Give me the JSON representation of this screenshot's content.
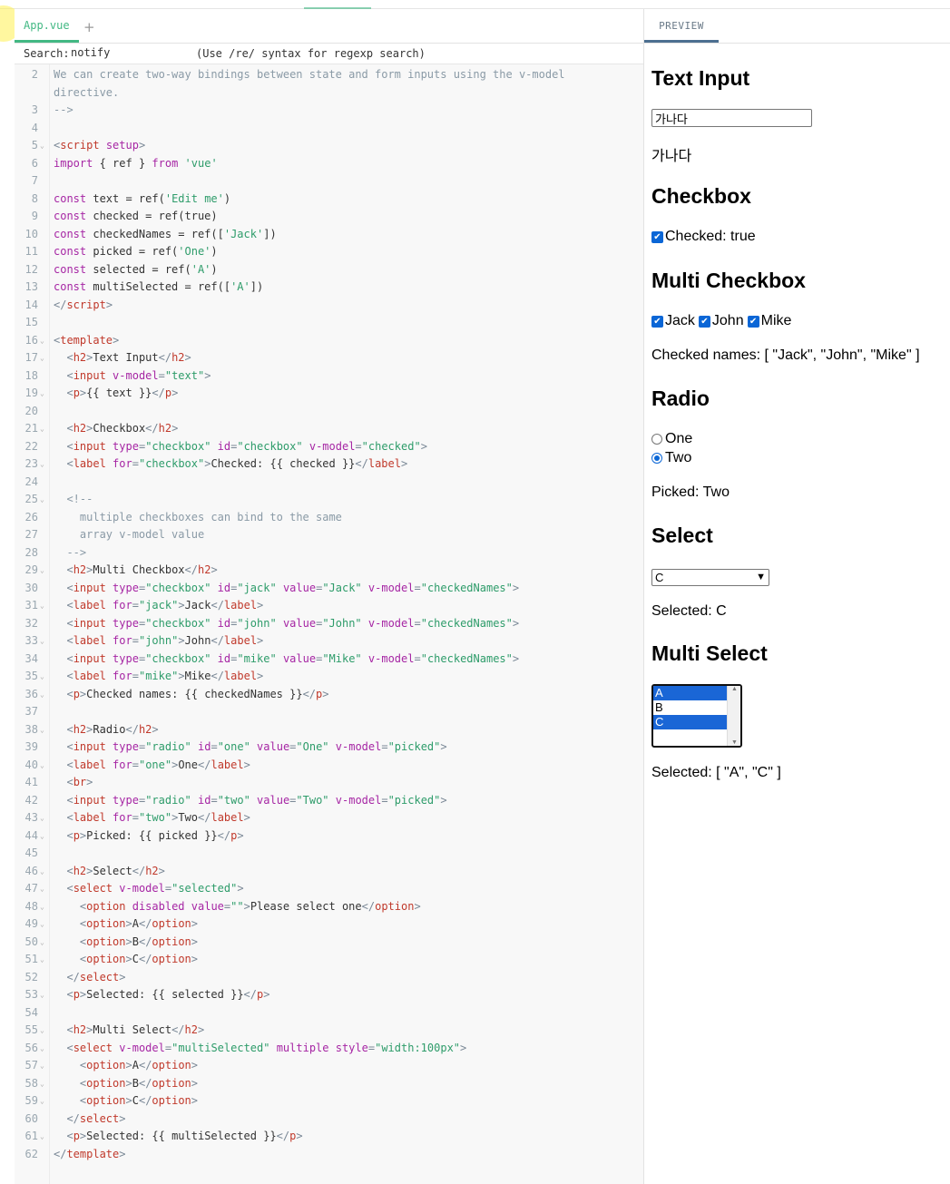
{
  "editor": {
    "tab": "App.vue",
    "add_tab": "+",
    "search_label": "Search:",
    "search_value": "notify",
    "search_hint": "(Use /re/ syntax for regexp search)",
    "lines": [
      {
        "n": "2",
        "fold": "",
        "html": "<span class='t-c'>We can create two-way bindings between state and form inputs using the v-model</span>"
      },
      {
        "n": "",
        "fold": "",
        "html": "<span class='t-c'>directive.</span>"
      },
      {
        "n": "3",
        "fold": "",
        "html": "<span class='t-c'>--></span>"
      },
      {
        "n": "4",
        "fold": "",
        "html": ""
      },
      {
        "n": "5",
        "fold": "v",
        "html": "<span class='t-p'>&lt;</span><span class='t-t'>script</span> <span class='t-a'>setup</span><span class='t-p'>&gt;</span>"
      },
      {
        "n": "6",
        "fold": "",
        "html": "<span class='t-k'>import</span> <span class='t-n'>{ ref }</span> <span class='t-k'>from</span> <span class='t-s'>'vue'</span>"
      },
      {
        "n": "7",
        "fold": "",
        "html": ""
      },
      {
        "n": "8",
        "fold": "",
        "html": "<span class='t-k'>const</span> <span class='t-n'>text = ref(</span><span class='t-s'>'Edit me'</span><span class='t-n'>)</span>"
      },
      {
        "n": "9",
        "fold": "",
        "html": "<span class='t-k'>const</span> <span class='t-n'>checked = ref(true)</span>"
      },
      {
        "n": "10",
        "fold": "",
        "html": "<span class='t-k'>const</span> <span class='t-n'>checkedNames = ref([</span><span class='t-s'>'Jack'</span><span class='t-n'>])</span>"
      },
      {
        "n": "11",
        "fold": "",
        "html": "<span class='t-k'>const</span> <span class='t-n'>picked = ref(</span><span class='t-s'>'One'</span><span class='t-n'>)</span>"
      },
      {
        "n": "12",
        "fold": "",
        "html": "<span class='t-k'>const</span> <span class='t-n'>selected = ref(</span><span class='t-s'>'A'</span><span class='t-n'>)</span>"
      },
      {
        "n": "13",
        "fold": "",
        "html": "<span class='t-k'>const</span> <span class='t-n'>multiSelected = ref([</span><span class='t-s'>'A'</span><span class='t-n'>])</span>"
      },
      {
        "n": "14",
        "fold": "",
        "html": "<span class='t-p'>&lt;/</span><span class='t-t'>script</span><span class='t-p'>&gt;</span>"
      },
      {
        "n": "15",
        "fold": "",
        "html": ""
      },
      {
        "n": "16",
        "fold": "v",
        "html": "<span class='t-p'>&lt;</span><span class='t-t'>template</span><span class='t-p'>&gt;</span>"
      },
      {
        "n": "17",
        "fold": "v",
        "html": "  <span class='t-p'>&lt;</span><span class='t-t'>h2</span><span class='t-p'>&gt;</span><span class='t-n'>Text Input</span><span class='t-p'>&lt;/</span><span class='t-t'>h2</span><span class='t-p'>&gt;</span>"
      },
      {
        "n": "18",
        "fold": "",
        "html": "  <span class='t-p'>&lt;</span><span class='t-t'>input</span> <span class='t-a'>v-model</span><span class='t-p'>=</span><span class='t-s'>\"text\"</span><span class='t-p'>&gt;</span>"
      },
      {
        "n": "19",
        "fold": "v",
        "html": "  <span class='t-p'>&lt;</span><span class='t-t'>p</span><span class='t-p'>&gt;</span><span class='t-n'>{{ text }}</span><span class='t-p'>&lt;/</span><span class='t-t'>p</span><span class='t-p'>&gt;</span>"
      },
      {
        "n": "20",
        "fold": "",
        "html": ""
      },
      {
        "n": "21",
        "fold": "v",
        "html": "  <span class='t-p'>&lt;</span><span class='t-t'>h2</span><span class='t-p'>&gt;</span><span class='t-n'>Checkbox</span><span class='t-p'>&lt;/</span><span class='t-t'>h2</span><span class='t-p'>&gt;</span>"
      },
      {
        "n": "22",
        "fold": "",
        "html": "  <span class='t-p'>&lt;</span><span class='t-t'>input</span> <span class='t-a'>type</span><span class='t-p'>=</span><span class='t-s'>\"checkbox\"</span> <span class='t-a'>id</span><span class='t-p'>=</span><span class='t-s'>\"checkbox\"</span> <span class='t-a'>v-model</span><span class='t-p'>=</span><span class='t-s'>\"checked\"</span><span class='t-p'>&gt;</span>"
      },
      {
        "n": "23",
        "fold": "v",
        "html": "  <span class='t-p'>&lt;</span><span class='t-t'>label</span> <span class='t-a'>for</span><span class='t-p'>=</span><span class='t-s'>\"checkbox\"</span><span class='t-p'>&gt;</span><span class='t-n'>Checked: {{ checked }}</span><span class='t-p'>&lt;/</span><span class='t-t'>label</span><span class='t-p'>&gt;</span>"
      },
      {
        "n": "24",
        "fold": "",
        "html": ""
      },
      {
        "n": "25",
        "fold": "v",
        "html": "  <span class='t-c'>&lt;!--</span>"
      },
      {
        "n": "26",
        "fold": "",
        "html": "    <span class='t-c'>multiple checkboxes can bind to the same</span>"
      },
      {
        "n": "27",
        "fold": "",
        "html": "    <span class='t-c'>array v-model value</span>"
      },
      {
        "n": "28",
        "fold": "",
        "html": "  <span class='t-c'>--></span>"
      },
      {
        "n": "29",
        "fold": "v",
        "html": "  <span class='t-p'>&lt;</span><span class='t-t'>h2</span><span class='t-p'>&gt;</span><span class='t-n'>Multi Checkbox</span><span class='t-p'>&lt;/</span><span class='t-t'>h2</span><span class='t-p'>&gt;</span>"
      },
      {
        "n": "30",
        "fold": "",
        "html": "  <span class='t-p'>&lt;</span><span class='t-t'>input</span> <span class='t-a'>type</span><span class='t-p'>=</span><span class='t-s'>\"checkbox\"</span> <span class='t-a'>id</span><span class='t-p'>=</span><span class='t-s'>\"jack\"</span> <span class='t-a'>value</span><span class='t-p'>=</span><span class='t-s'>\"Jack\"</span> <span class='t-a'>v-model</span><span class='t-p'>=</span><span class='t-s'>\"checkedNames\"</span><span class='t-p'>&gt;</span>"
      },
      {
        "n": "31",
        "fold": "v",
        "html": "  <span class='t-p'>&lt;</span><span class='t-t'>label</span> <span class='t-a'>for</span><span class='t-p'>=</span><span class='t-s'>\"jack\"</span><span class='t-p'>&gt;</span><span class='t-n'>Jack</span><span class='t-p'>&lt;/</span><span class='t-t'>label</span><span class='t-p'>&gt;</span>"
      },
      {
        "n": "32",
        "fold": "",
        "html": "  <span class='t-p'>&lt;</span><span class='t-t'>input</span> <span class='t-a'>type</span><span class='t-p'>=</span><span class='t-s'>\"checkbox\"</span> <span class='t-a'>id</span><span class='t-p'>=</span><span class='t-s'>\"john\"</span> <span class='t-a'>value</span><span class='t-p'>=</span><span class='t-s'>\"John\"</span> <span class='t-a'>v-model</span><span class='t-p'>=</span><span class='t-s'>\"checkedNames\"</span><span class='t-p'>&gt;</span>"
      },
      {
        "n": "33",
        "fold": "v",
        "html": "  <span class='t-p'>&lt;</span><span class='t-t'>label</span> <span class='t-a'>for</span><span class='t-p'>=</span><span class='t-s'>\"john\"</span><span class='t-p'>&gt;</span><span class='t-n'>John</span><span class='t-p'>&lt;/</span><span class='t-t'>label</span><span class='t-p'>&gt;</span>"
      },
      {
        "n": "34",
        "fold": "",
        "html": "  <span class='t-p'>&lt;</span><span class='t-t'>input</span> <span class='t-a'>type</span><span class='t-p'>=</span><span class='t-s'>\"checkbox\"</span> <span class='t-a'>id</span><span class='t-p'>=</span><span class='t-s'>\"mike\"</span> <span class='t-a'>value</span><span class='t-p'>=</span><span class='t-s'>\"Mike\"</span> <span class='t-a'>v-model</span><span class='t-p'>=</span><span class='t-s'>\"checkedNames\"</span><span class='t-p'>&gt;</span>"
      },
      {
        "n": "35",
        "fold": "v",
        "html": "  <span class='t-p'>&lt;</span><span class='t-t'>label</span> <span class='t-a'>for</span><span class='t-p'>=</span><span class='t-s'>\"mike\"</span><span class='t-p'>&gt;</span><span class='t-n'>Mike</span><span class='t-p'>&lt;/</span><span class='t-t'>label</span><span class='t-p'>&gt;</span>"
      },
      {
        "n": "36",
        "fold": "v",
        "html": "  <span class='t-p'>&lt;</span><span class='t-t'>p</span><span class='t-p'>&gt;</span><span class='t-n'>Checked names: {{ checkedNames }}</span><span class='t-p'>&lt;/</span><span class='t-t'>p</span><span class='t-p'>&gt;</span>"
      },
      {
        "n": "37",
        "fold": "",
        "html": ""
      },
      {
        "n": "38",
        "fold": "v",
        "html": "  <span class='t-p'>&lt;</span><span class='t-t'>h2</span><span class='t-p'>&gt;</span><span class='t-n'>Radio</span><span class='t-p'>&lt;/</span><span class='t-t'>h2</span><span class='t-p'>&gt;</span>"
      },
      {
        "n": "39",
        "fold": "",
        "html": "  <span class='t-p'>&lt;</span><span class='t-t'>input</span> <span class='t-a'>type</span><span class='t-p'>=</span><span class='t-s'>\"radio\"</span> <span class='t-a'>id</span><span class='t-p'>=</span><span class='t-s'>\"one\"</span> <span class='t-a'>value</span><span class='t-p'>=</span><span class='t-s'>\"One\"</span> <span class='t-a'>v-model</span><span class='t-p'>=</span><span class='t-s'>\"picked\"</span><span class='t-p'>&gt;</span>"
      },
      {
        "n": "40",
        "fold": "v",
        "html": "  <span class='t-p'>&lt;</span><span class='t-t'>label</span> <span class='t-a'>for</span><span class='t-p'>=</span><span class='t-s'>\"one\"</span><span class='t-p'>&gt;</span><span class='t-n'>One</span><span class='t-p'>&lt;/</span><span class='t-t'>label</span><span class='t-p'>&gt;</span>"
      },
      {
        "n": "41",
        "fold": "",
        "html": "  <span class='t-p'>&lt;</span><span class='t-t'>br</span><span class='t-p'>&gt;</span>"
      },
      {
        "n": "42",
        "fold": "",
        "html": "  <span class='t-p'>&lt;</span><span class='t-t'>input</span> <span class='t-a'>type</span><span class='t-p'>=</span><span class='t-s'>\"radio\"</span> <span class='t-a'>id</span><span class='t-p'>=</span><span class='t-s'>\"two\"</span> <span class='t-a'>value</span><span class='t-p'>=</span><span class='t-s'>\"Two\"</span> <span class='t-a'>v-model</span><span class='t-p'>=</span><span class='t-s'>\"picked\"</span><span class='t-p'>&gt;</span>"
      },
      {
        "n": "43",
        "fold": "v",
        "html": "  <span class='t-p'>&lt;</span><span class='t-t'>label</span> <span class='t-a'>for</span><span class='t-p'>=</span><span class='t-s'>\"two\"</span><span class='t-p'>&gt;</span><span class='t-n'>Two</span><span class='t-p'>&lt;/</span><span class='t-t'>label</span><span class='t-p'>&gt;</span>"
      },
      {
        "n": "44",
        "fold": "v",
        "html": "  <span class='t-p'>&lt;</span><span class='t-t'>p</span><span class='t-p'>&gt;</span><span class='t-n'>Picked: {{ picked }}</span><span class='t-p'>&lt;/</span><span class='t-t'>p</span><span class='t-p'>&gt;</span>"
      },
      {
        "n": "45",
        "fold": "",
        "html": ""
      },
      {
        "n": "46",
        "fold": "v",
        "html": "  <span class='t-p'>&lt;</span><span class='t-t'>h2</span><span class='t-p'>&gt;</span><span class='t-n'>Select</span><span class='t-p'>&lt;/</span><span class='t-t'>h2</span><span class='t-p'>&gt;</span>"
      },
      {
        "n": "47",
        "fold": "v",
        "html": "  <span class='t-p'>&lt;</span><span class='t-t'>select</span> <span class='t-a'>v-model</span><span class='t-p'>=</span><span class='t-s'>\"selected\"</span><span class='t-p'>&gt;</span>"
      },
      {
        "n": "48",
        "fold": "v",
        "html": "    <span class='t-p'>&lt;</span><span class='t-t'>option</span> <span class='t-a'>disabled</span> <span class='t-a'>value</span><span class='t-p'>=</span><span class='t-s'>\"\"</span><span class='t-p'>&gt;</span><span class='t-n'>Please select one</span><span class='t-p'>&lt;/</span><span class='t-t'>option</span><span class='t-p'>&gt;</span>"
      },
      {
        "n": "49",
        "fold": "v",
        "html": "    <span class='t-p'>&lt;</span><span class='t-t'>option</span><span class='t-p'>&gt;</span><span class='t-n'>A</span><span class='t-p'>&lt;/</span><span class='t-t'>option</span><span class='t-p'>&gt;</span>"
      },
      {
        "n": "50",
        "fold": "v",
        "html": "    <span class='t-p'>&lt;</span><span class='t-t'>option</span><span class='t-p'>&gt;</span><span class='t-n'>B</span><span class='t-p'>&lt;/</span><span class='t-t'>option</span><span class='t-p'>&gt;</span>"
      },
      {
        "n": "51",
        "fold": "v",
        "html": "    <span class='t-p'>&lt;</span><span class='t-t'>option</span><span class='t-p'>&gt;</span><span class='t-n'>C</span><span class='t-p'>&lt;/</span><span class='t-t'>option</span><span class='t-p'>&gt;</span>"
      },
      {
        "n": "52",
        "fold": "",
        "html": "  <span class='t-p'>&lt;/</span><span class='t-t'>select</span><span class='t-p'>&gt;</span>"
      },
      {
        "n": "53",
        "fold": "v",
        "html": "  <span class='t-p'>&lt;</span><span class='t-t'>p</span><span class='t-p'>&gt;</span><span class='t-n'>Selected: {{ selected }}</span><span class='t-p'>&lt;/</span><span class='t-t'>p</span><span class='t-p'>&gt;</span>"
      },
      {
        "n": "54",
        "fold": "",
        "html": ""
      },
      {
        "n": "55",
        "fold": "v",
        "html": "  <span class='t-p'>&lt;</span><span class='t-t'>h2</span><span class='t-p'>&gt;</span><span class='t-n'>Multi Select</span><span class='t-p'>&lt;/</span><span class='t-t'>h2</span><span class='t-p'>&gt;</span>"
      },
      {
        "n": "56",
        "fold": "v",
        "html": "  <span class='t-p'>&lt;</span><span class='t-t'>select</span> <span class='t-a'>v-model</span><span class='t-p'>=</span><span class='t-s'>\"multiSelected\"</span> <span class='t-a'>multiple</span> <span class='t-a'>style</span><span class='t-p'>=</span><span class='t-s'>\"width:100px\"</span><span class='t-p'>&gt;</span>"
      },
      {
        "n": "57",
        "fold": "v",
        "html": "    <span class='t-p'>&lt;</span><span class='t-t'>option</span><span class='t-p'>&gt;</span><span class='t-n'>A</span><span class='t-p'>&lt;/</span><span class='t-t'>option</span><span class='t-p'>&gt;</span>"
      },
      {
        "n": "58",
        "fold": "v",
        "html": "    <span class='t-p'>&lt;</span><span class='t-t'>option</span><span class='t-p'>&gt;</span><span class='t-n'>B</span><span class='t-p'>&lt;/</span><span class='t-t'>option</span><span class='t-p'>&gt;</span>"
      },
      {
        "n": "59",
        "fold": "v",
        "html": "    <span class='t-p'>&lt;</span><span class='t-t'>option</span><span class='t-p'>&gt;</span><span class='t-n'>C</span><span class='t-p'>&lt;/</span><span class='t-t'>option</span><span class='t-p'>&gt;</span>"
      },
      {
        "n": "60",
        "fold": "",
        "html": "  <span class='t-p'>&lt;/</span><span class='t-t'>select</span><span class='t-p'>&gt;</span>"
      },
      {
        "n": "61",
        "fold": "v",
        "html": "  <span class='t-p'>&lt;</span><span class='t-t'>p</span><span class='t-p'>&gt;</span><span class='t-n'>Selected: {{ multiSelected }}</span><span class='t-p'>&lt;/</span><span class='t-t'>p</span><span class='t-p'>&gt;</span>"
      },
      {
        "n": "62",
        "fold": "",
        "html": "<span class='t-p'>&lt;/</span><span class='t-t'>template</span><span class='t-p'>&gt;</span>"
      }
    ]
  },
  "preview": {
    "tab": "PREVIEW",
    "text_input": {
      "heading": "Text Input",
      "value": "가나다",
      "output": "가나다"
    },
    "checkbox": {
      "heading": "Checkbox",
      "label": "Checked: true"
    },
    "multi_checkbox": {
      "heading": "Multi Checkbox",
      "items": [
        "Jack",
        "John",
        "Mike"
      ],
      "output": "Checked names: [ \"Jack\", \"John\", \"Mike\" ]"
    },
    "radio": {
      "heading": "Radio",
      "one": "One",
      "two": "Two",
      "output": "Picked: Two"
    },
    "select": {
      "heading": "Select",
      "value": "C",
      "output": "Selected: C"
    },
    "multi_select": {
      "heading": "Multi Select",
      "options": [
        "A",
        "B",
        "C"
      ],
      "output": "Selected: [ \"A\", \"C\" ]"
    }
  },
  "colors": {
    "accent": "#42b883",
    "checkbox": "#0a66d6",
    "selected_option": "#1a66d6"
  }
}
